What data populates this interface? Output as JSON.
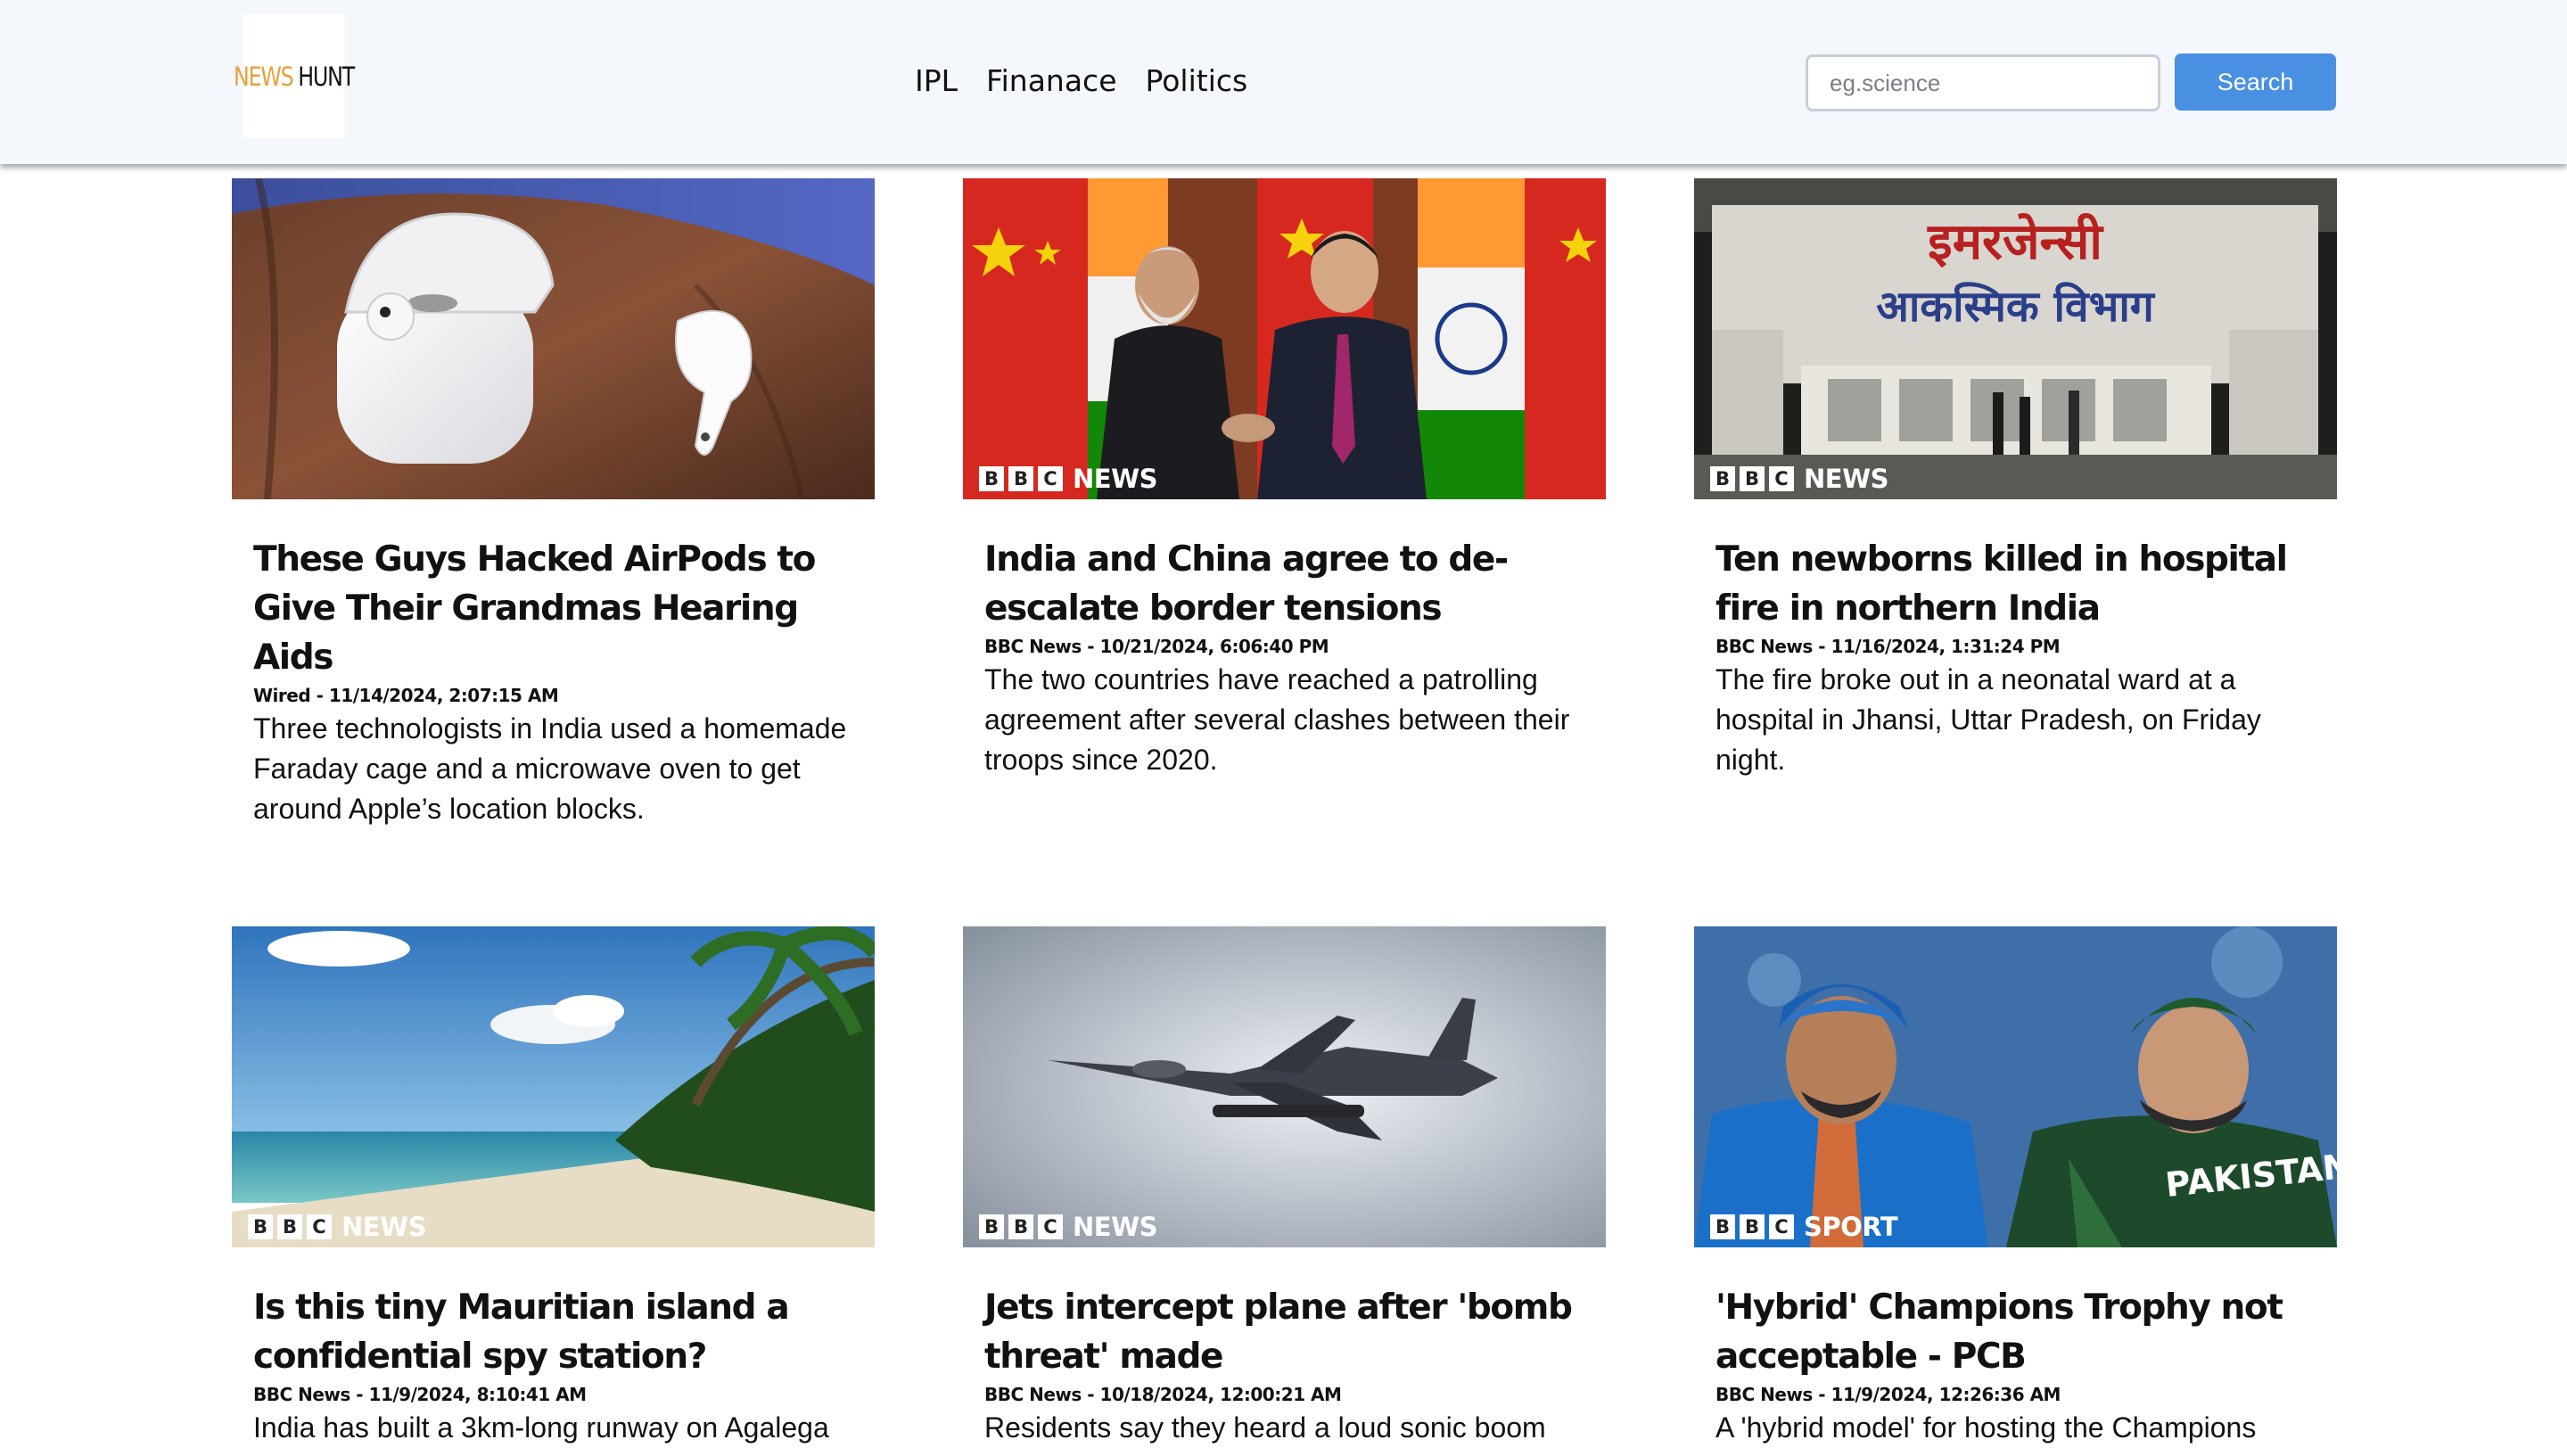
{
  "header": {
    "logo": {
      "part1": "NEWS",
      "part2": "HUNT",
      "color1": "#e6a23c",
      "color2": "#111111"
    },
    "nav": [
      "IPL",
      "Finanace",
      "Politics"
    ],
    "search": {
      "placeholder": "eg.science",
      "value": "",
      "button_label": "Search",
      "button_color": "#4a90e2"
    }
  },
  "articles": [
    {
      "title": "These Guys Hacked AirPods to Give Their Grandmas Hearing Aids",
      "meta": "Wired - 11/14/2024, 2:07:15 AM",
      "description": "Three technologists in India used a homemade Faraday cage and a microwave oven to get around Apple’s location blocks.",
      "badge": null
    },
    {
      "title": "India and China agree to de-escalate border tensions",
      "meta": "BBC News - 10/21/2024, 6:06:40 PM",
      "description": "The two countries have reached a patrolling agreement after several clashes between their troops since 2020.",
      "badge": {
        "b1": "B",
        "b2": "B",
        "b3": "C",
        "word": "NEWS"
      }
    },
    {
      "title": "Ten newborns killed in hospital fire in northern India",
      "meta": "BBC News - 11/16/2024, 1:31:24 PM",
      "description": "The fire broke out in a neonatal ward at a hospital in Jhansi, Uttar Pradesh, on Friday night.",
      "badge": {
        "b1": "B",
        "b2": "B",
        "b3": "C",
        "word": "NEWS"
      },
      "image_text": {
        "line1": "इमरजेन्सी",
        "line2": "आकस्मिक  विभाग"
      }
    },
    {
      "title": "Is this tiny Mauritian island a confidential spy station?",
      "meta": "BBC News - 11/9/2024, 8:10:41 AM",
      "description": "India has built a 3km-long runway on Agalega",
      "badge": {
        "b1": "B",
        "b2": "B",
        "b3": "C",
        "word": "NEWS"
      }
    },
    {
      "title": "Jets intercept plane after 'bomb threat' made",
      "meta": "BBC News - 10/18/2024, 12:00:21 AM",
      "description": "Residents say they heard a loud sonic boom",
      "badge": {
        "b1": "B",
        "b2": "B",
        "b3": "C",
        "word": "NEWS"
      }
    },
    {
      "title": "'Hybrid' Champions Trophy not acceptable - PCB",
      "meta": "BBC News - 11/9/2024, 12:26:36 AM",
      "description": "A 'hybrid model' for hosting the Champions",
      "badge": {
        "b1": "B",
        "b2": "B",
        "b3": "C",
        "word": "SPORT"
      },
      "image_text": {
        "jersey": "PAKISTAN"
      }
    }
  ]
}
